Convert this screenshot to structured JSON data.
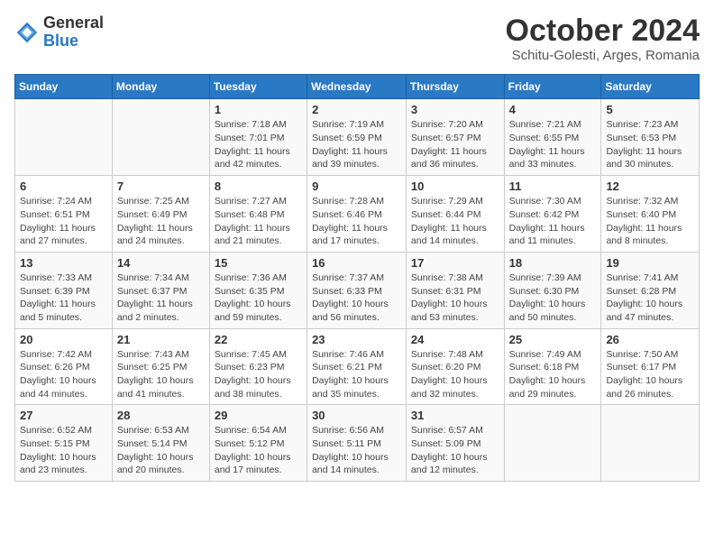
{
  "logo": {
    "text_general": "General",
    "text_blue": "Blue"
  },
  "title": "October 2024",
  "subtitle": "Schitu-Golesti, Arges, Romania",
  "days_of_week": [
    "Sunday",
    "Monday",
    "Tuesday",
    "Wednesday",
    "Thursday",
    "Friday",
    "Saturday"
  ],
  "weeks": [
    [
      {
        "day": "",
        "detail": ""
      },
      {
        "day": "",
        "detail": ""
      },
      {
        "day": "1",
        "detail": "Sunrise: 7:18 AM\nSunset: 7:01 PM\nDaylight: 11 hours and 42 minutes."
      },
      {
        "day": "2",
        "detail": "Sunrise: 7:19 AM\nSunset: 6:59 PM\nDaylight: 11 hours and 39 minutes."
      },
      {
        "day": "3",
        "detail": "Sunrise: 7:20 AM\nSunset: 6:57 PM\nDaylight: 11 hours and 36 minutes."
      },
      {
        "day": "4",
        "detail": "Sunrise: 7:21 AM\nSunset: 6:55 PM\nDaylight: 11 hours and 33 minutes."
      },
      {
        "day": "5",
        "detail": "Sunrise: 7:23 AM\nSunset: 6:53 PM\nDaylight: 11 hours and 30 minutes."
      }
    ],
    [
      {
        "day": "6",
        "detail": "Sunrise: 7:24 AM\nSunset: 6:51 PM\nDaylight: 11 hours and 27 minutes."
      },
      {
        "day": "7",
        "detail": "Sunrise: 7:25 AM\nSunset: 6:49 PM\nDaylight: 11 hours and 24 minutes."
      },
      {
        "day": "8",
        "detail": "Sunrise: 7:27 AM\nSunset: 6:48 PM\nDaylight: 11 hours and 21 minutes."
      },
      {
        "day": "9",
        "detail": "Sunrise: 7:28 AM\nSunset: 6:46 PM\nDaylight: 11 hours and 17 minutes."
      },
      {
        "day": "10",
        "detail": "Sunrise: 7:29 AM\nSunset: 6:44 PM\nDaylight: 11 hours and 14 minutes."
      },
      {
        "day": "11",
        "detail": "Sunrise: 7:30 AM\nSunset: 6:42 PM\nDaylight: 11 hours and 11 minutes."
      },
      {
        "day": "12",
        "detail": "Sunrise: 7:32 AM\nSunset: 6:40 PM\nDaylight: 11 hours and 8 minutes."
      }
    ],
    [
      {
        "day": "13",
        "detail": "Sunrise: 7:33 AM\nSunset: 6:39 PM\nDaylight: 11 hours and 5 minutes."
      },
      {
        "day": "14",
        "detail": "Sunrise: 7:34 AM\nSunset: 6:37 PM\nDaylight: 11 hours and 2 minutes."
      },
      {
        "day": "15",
        "detail": "Sunrise: 7:36 AM\nSunset: 6:35 PM\nDaylight: 10 hours and 59 minutes."
      },
      {
        "day": "16",
        "detail": "Sunrise: 7:37 AM\nSunset: 6:33 PM\nDaylight: 10 hours and 56 minutes."
      },
      {
        "day": "17",
        "detail": "Sunrise: 7:38 AM\nSunset: 6:31 PM\nDaylight: 10 hours and 53 minutes."
      },
      {
        "day": "18",
        "detail": "Sunrise: 7:39 AM\nSunset: 6:30 PM\nDaylight: 10 hours and 50 minutes."
      },
      {
        "day": "19",
        "detail": "Sunrise: 7:41 AM\nSunset: 6:28 PM\nDaylight: 10 hours and 47 minutes."
      }
    ],
    [
      {
        "day": "20",
        "detail": "Sunrise: 7:42 AM\nSunset: 6:26 PM\nDaylight: 10 hours and 44 minutes."
      },
      {
        "day": "21",
        "detail": "Sunrise: 7:43 AM\nSunset: 6:25 PM\nDaylight: 10 hours and 41 minutes."
      },
      {
        "day": "22",
        "detail": "Sunrise: 7:45 AM\nSunset: 6:23 PM\nDaylight: 10 hours and 38 minutes."
      },
      {
        "day": "23",
        "detail": "Sunrise: 7:46 AM\nSunset: 6:21 PM\nDaylight: 10 hours and 35 minutes."
      },
      {
        "day": "24",
        "detail": "Sunrise: 7:48 AM\nSunset: 6:20 PM\nDaylight: 10 hours and 32 minutes."
      },
      {
        "day": "25",
        "detail": "Sunrise: 7:49 AM\nSunset: 6:18 PM\nDaylight: 10 hours and 29 minutes."
      },
      {
        "day": "26",
        "detail": "Sunrise: 7:50 AM\nSunset: 6:17 PM\nDaylight: 10 hours and 26 minutes."
      }
    ],
    [
      {
        "day": "27",
        "detail": "Sunrise: 6:52 AM\nSunset: 5:15 PM\nDaylight: 10 hours and 23 minutes."
      },
      {
        "day": "28",
        "detail": "Sunrise: 6:53 AM\nSunset: 5:14 PM\nDaylight: 10 hours and 20 minutes."
      },
      {
        "day": "29",
        "detail": "Sunrise: 6:54 AM\nSunset: 5:12 PM\nDaylight: 10 hours and 17 minutes."
      },
      {
        "day": "30",
        "detail": "Sunrise: 6:56 AM\nSunset: 5:11 PM\nDaylight: 10 hours and 14 minutes."
      },
      {
        "day": "31",
        "detail": "Sunrise: 6:57 AM\nSunset: 5:09 PM\nDaylight: 10 hours and 12 minutes."
      },
      {
        "day": "",
        "detail": ""
      },
      {
        "day": "",
        "detail": ""
      }
    ]
  ]
}
